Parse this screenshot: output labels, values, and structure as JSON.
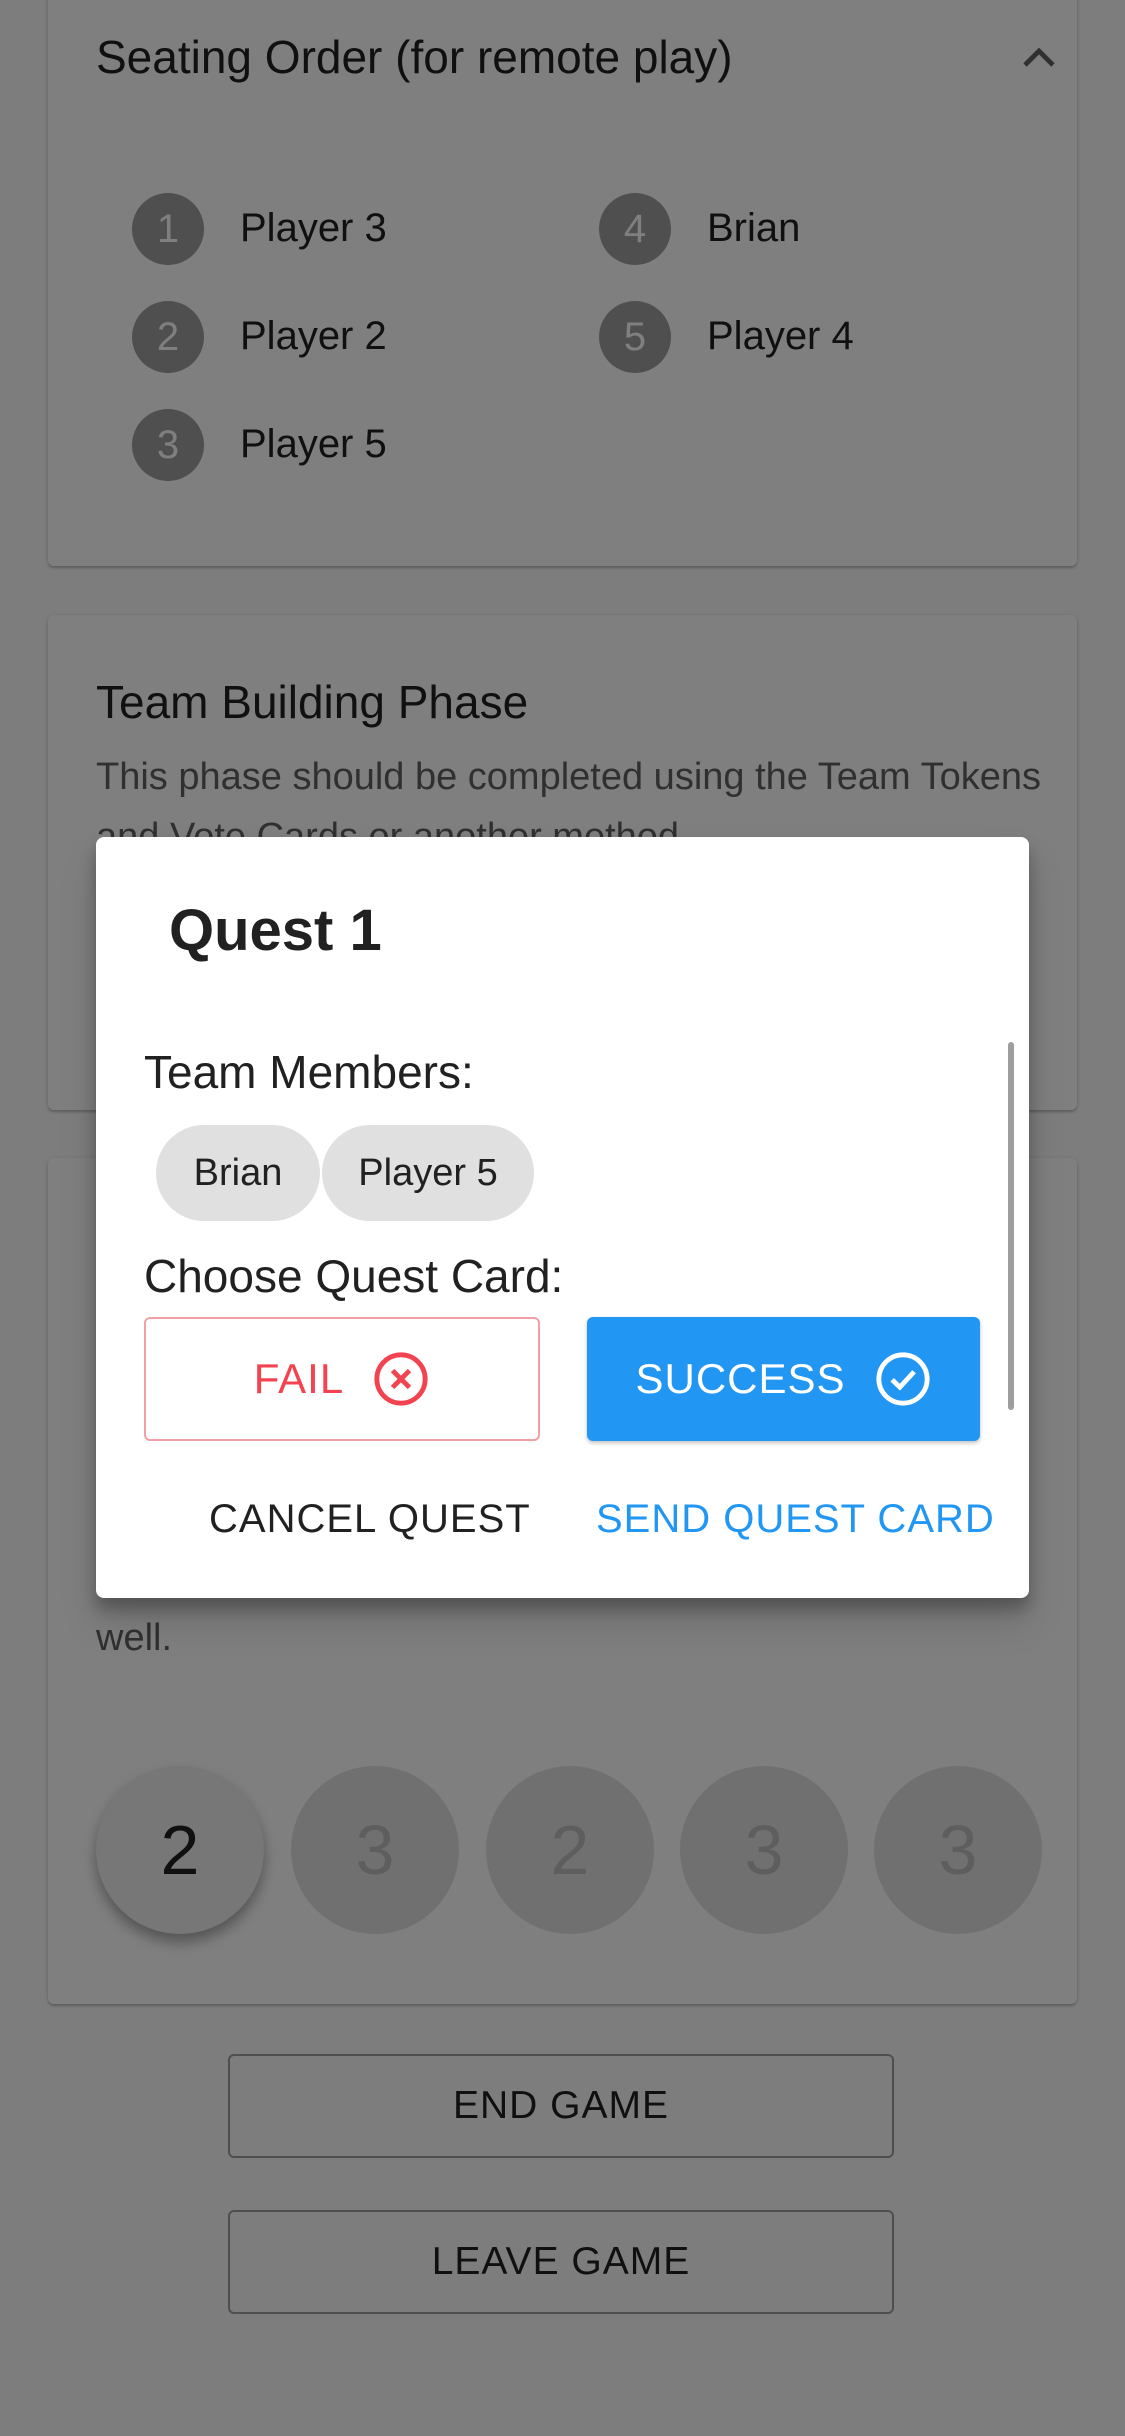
{
  "seating": {
    "title": "Seating Order (for remote play)",
    "entries": [
      {
        "num": "1",
        "name": "Player 3"
      },
      {
        "num": "2",
        "name": "Player 2"
      },
      {
        "num": "3",
        "name": "Player 5"
      },
      {
        "num": "4",
        "name": "Brian"
      },
      {
        "num": "5",
        "name": "Player 4"
      }
    ]
  },
  "team_building": {
    "title": "Team Building Phase",
    "description": "This phase should be completed using the Team Tokens and Vote Cards or another method."
  },
  "quest_section": {
    "trailing_text": "well.",
    "circles": [
      "2",
      "3",
      "2",
      "3",
      "3"
    ]
  },
  "buttons": {
    "end_game": "END GAME",
    "leave_game": "LEAVE GAME"
  },
  "dialog": {
    "title": "Quest 1",
    "team_members_label": "Team Members:",
    "members": [
      "Brian",
      "Player 5"
    ],
    "choose_label": "Choose Quest Card:",
    "fail_label": "FAIL",
    "success_label": "SUCCESS",
    "cancel_label": "CANCEL QUEST",
    "send_label": "SEND QUEST CARD"
  },
  "colors": {
    "accent": "#2196f3",
    "fail": "#f44350",
    "scrim": "rgba(0,0,0,0.5)"
  }
}
